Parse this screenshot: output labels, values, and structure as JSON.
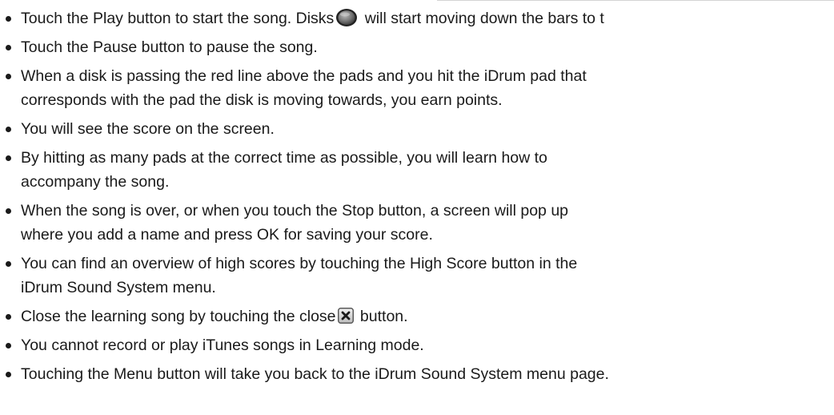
{
  "instructions": [
    {
      "lines": [
        "Touch the Play button to start the song. Disks"
      ],
      "after_icon": " will start moving down the bars to t",
      "icon": "disk-icon"
    },
    {
      "lines": [
        "Touch the Pause button to pause the song."
      ]
    },
    {
      "lines": [
        "When a disk is passing the red line above the pads and you hit the iDrum pad that",
        "corresponds with the pad the disk is moving towards, you earn points."
      ]
    },
    {
      "lines": [
        "You will see the score on the screen."
      ]
    },
    {
      "lines": [
        "By hitting as many pads at the correct time as possible, you will learn how to",
        "accompany the song."
      ]
    },
    {
      "lines": [
        "When the song is over, or when you touch the Stop button, a screen will pop up",
        "where you add a name and press OK for saving your score."
      ]
    },
    {
      "lines": [
        "You can find an overview of high scores by touching the High Score button in the",
        "iDrum Sound System menu."
      ]
    },
    {
      "lines": [
        "Close the learning song by touching the close"
      ],
      "after_icon": " button.",
      "icon": "close-icon"
    },
    {
      "lines": [
        "You cannot record or play iTunes songs in Learning mode."
      ]
    },
    {
      "lines": [
        "Touching the Menu button will take you back to the iDrum Sound System menu page."
      ]
    }
  ]
}
